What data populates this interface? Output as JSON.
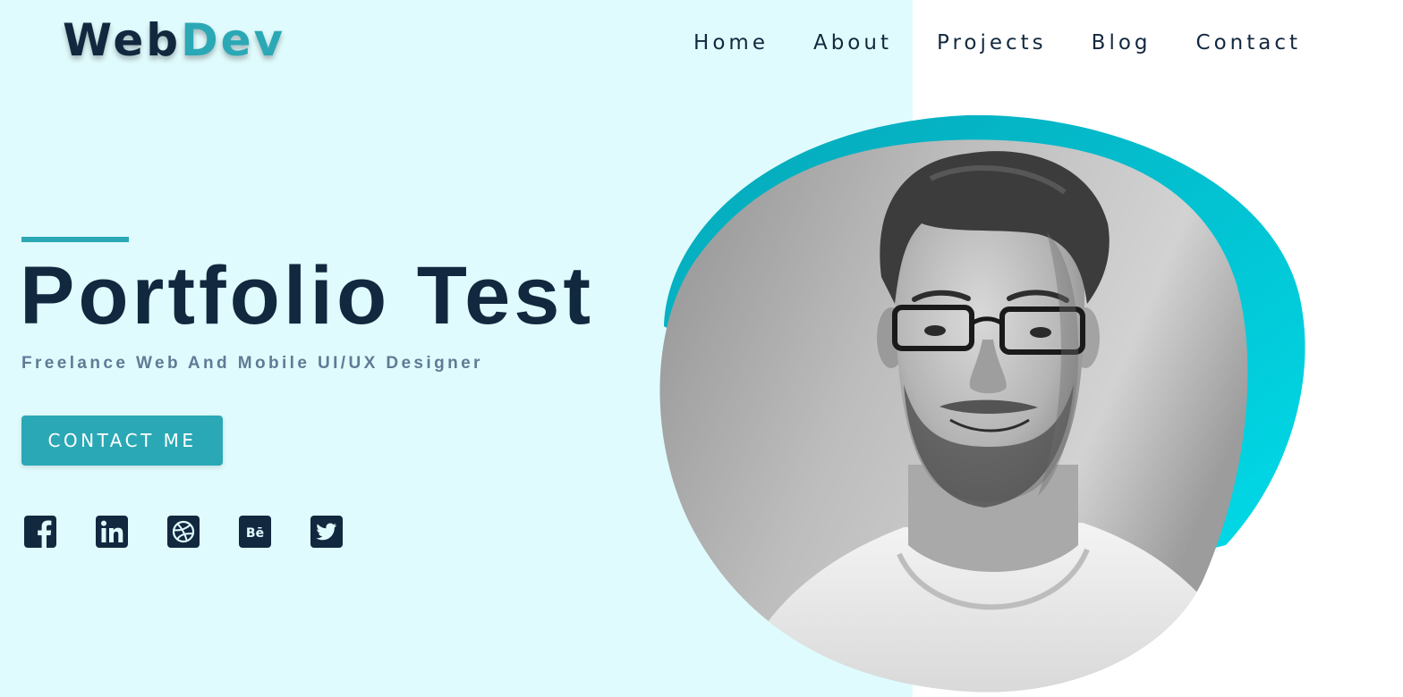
{
  "colors": {
    "left_background": "#e0fbfd",
    "right_background": "#ffffff",
    "navy": "#12283f",
    "accent": "#2ba8b5",
    "subtitle": "#5f7b95",
    "blob_gradient_start": "#06a7b8",
    "blob_gradient_end": "#00dbe9"
  },
  "logo": {
    "part_a": "Web",
    "part_b": "Dev"
  },
  "nav": {
    "items": [
      {
        "label": "Home"
      },
      {
        "label": "About"
      },
      {
        "label": "Projects"
      },
      {
        "label": "Blog"
      },
      {
        "label": "Contact"
      }
    ]
  },
  "hero": {
    "title": "Portfolio Test",
    "subtitle": "Freelance Web And Mobile UI/UX Designer",
    "cta_label": "CONTACT ME"
  },
  "socials": [
    {
      "icon": "facebook-icon"
    },
    {
      "icon": "linkedin-icon"
    },
    {
      "icon": "dribbble-icon"
    },
    {
      "icon": "behance-icon"
    },
    {
      "icon": "twitter-icon"
    }
  ],
  "portrait": {
    "icon": "portrait-photo",
    "style": "grayscale"
  }
}
